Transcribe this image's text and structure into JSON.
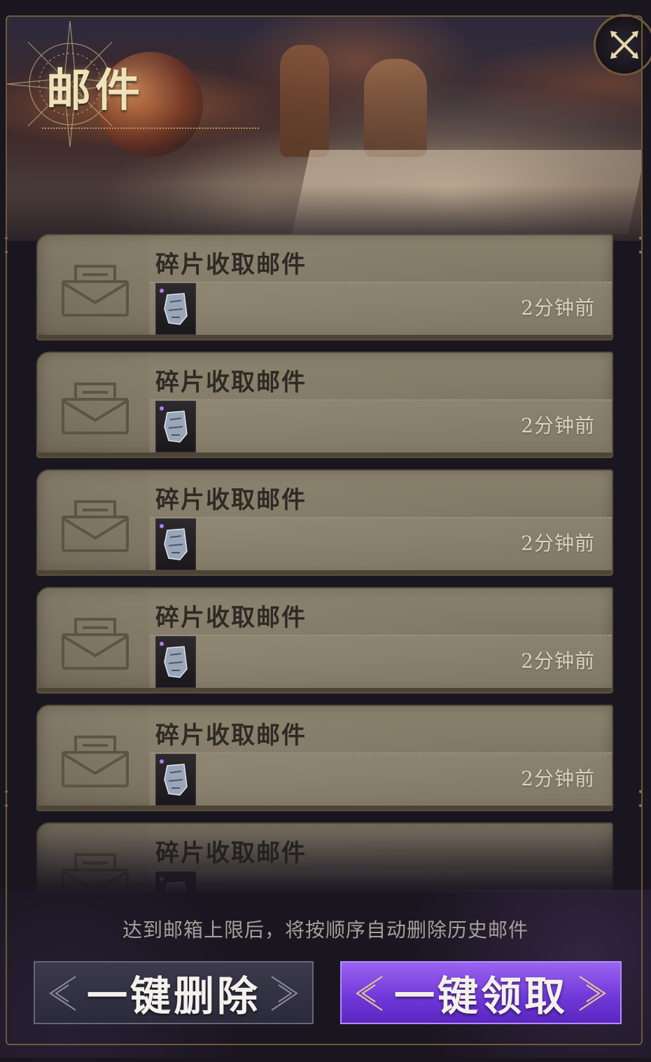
{
  "header": {
    "title": "邮件",
    "close_icon": "close-x-icon"
  },
  "mails": [
    {
      "title": "碎片收取邮件",
      "time": "2分钟前",
      "icon": "envelope-icon",
      "item_icon": "fragment-item-icon"
    },
    {
      "title": "碎片收取邮件",
      "time": "2分钟前",
      "icon": "envelope-icon",
      "item_icon": "fragment-item-icon"
    },
    {
      "title": "碎片收取邮件",
      "time": "2分钟前",
      "icon": "envelope-icon",
      "item_icon": "fragment-item-icon"
    },
    {
      "title": "碎片收取邮件",
      "time": "2分钟前",
      "icon": "envelope-icon",
      "item_icon": "fragment-item-icon"
    },
    {
      "title": "碎片收取邮件",
      "time": "2分钟前",
      "icon": "envelope-icon",
      "item_icon": "fragment-item-icon"
    },
    {
      "title": "碎片收取邮件",
      "time": "",
      "icon": "envelope-icon",
      "item_icon": "fragment-item-icon"
    }
  ],
  "footer": {
    "notice": "达到邮箱上限后，将按顺序自动删除历史邮件",
    "delete_all_label": "一键删除",
    "claim_all_label": "一键领取"
  },
  "colors": {
    "claim_button": "#7a45e0",
    "delete_button": "#34334a",
    "gold_trim": "#b89a5e",
    "mail_card": "#857c68"
  }
}
